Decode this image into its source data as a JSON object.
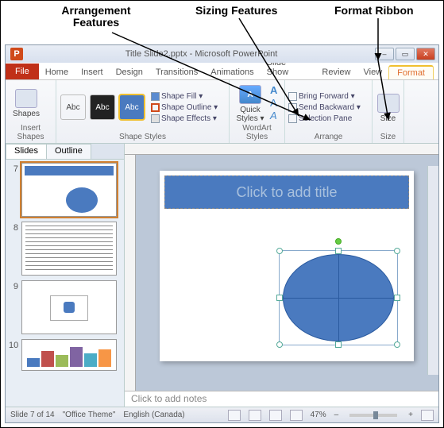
{
  "annotations": {
    "arrangement": "Arrangement Features",
    "sizing": "Sizing Features",
    "format_ribbon": "Format Ribbon"
  },
  "window": {
    "title": "Title Slide2.pptx - Microsoft PowerPoint",
    "app_letter": "P",
    "min": "–",
    "max": "▭",
    "close": "✕"
  },
  "tabs": {
    "file": "File",
    "home": "Home",
    "insert": "Insert",
    "design": "Design",
    "transitions": "Transitions",
    "animations": "Animations",
    "slideshow": "Slide Show",
    "review": "Review",
    "view": "View",
    "format": "Format"
  },
  "ribbon": {
    "insert_shapes": {
      "label": "Insert Shapes",
      "shapes": "Shapes"
    },
    "shape_styles": {
      "label": "Shape Styles",
      "swatch_text": "Abc",
      "fill": "Shape Fill ▾",
      "outline": "Shape Outline ▾",
      "effects": "Shape Effects ▾"
    },
    "wordart": {
      "label": "WordArt Styles",
      "quick": "Quick Styles ▾"
    },
    "arrange": {
      "label": "Arrange",
      "bring_forward": "Bring Forward ▾",
      "send_backward": "Send Backward ▾",
      "selection_pane": "Selection Pane"
    },
    "size": {
      "label": "Size",
      "btn": "Size"
    }
  },
  "sidepane": {
    "slides_tab": "Slides",
    "outline_tab": "Outline",
    "thumbs": [
      "7",
      "8",
      "9",
      "10"
    ]
  },
  "slide": {
    "title_placeholder": "Click to add title"
  },
  "notes": {
    "placeholder": "Click to add notes"
  },
  "status": {
    "slide_info": "Slide 7 of 14",
    "theme": "\"Office Theme\"",
    "language": "English (Canada)",
    "zoom": "47%",
    "minus": "–",
    "plus": "+"
  },
  "chart_data": null
}
